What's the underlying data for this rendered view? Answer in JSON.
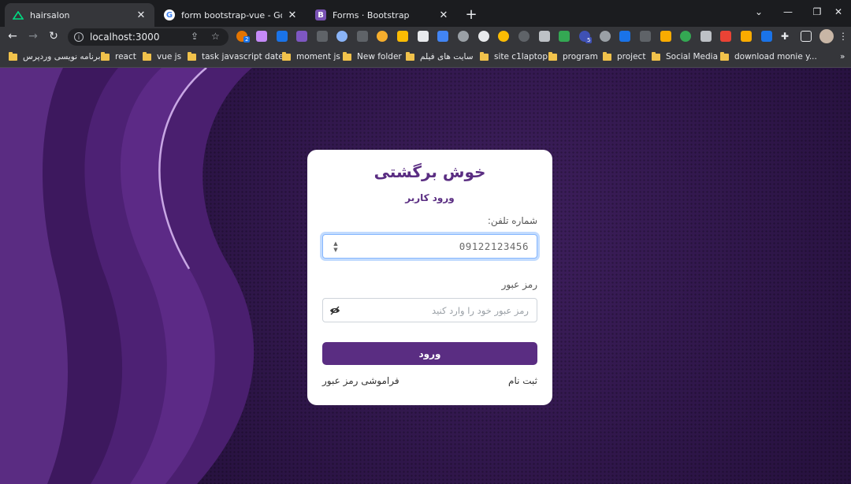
{
  "browser": {
    "tabs": [
      {
        "title": "hairsalon",
        "icon": "nuxt-icon"
      },
      {
        "title": "form bootstrap-vue - Google Sea",
        "icon": "google-icon"
      },
      {
        "title": "Forms · Bootstrap",
        "icon": "bootstrap-icon"
      }
    ],
    "url": "localhost:3000",
    "bookmarks": [
      "برنامه نویسی وردپرس",
      "react",
      "vue js",
      "task javascript date...",
      "moment js",
      "New folder",
      "سایت های فیلم",
      "site c1laptop",
      "program",
      "project",
      "Social Media",
      "download monie y..."
    ],
    "extension_badges": [
      "2",
      "5"
    ]
  },
  "login": {
    "title": "خوش برگشتی",
    "subtitle": "ورود کاربر",
    "phone_label": "شماره تلفن:",
    "phone_value": "09122123456",
    "password_label": "رمز عبور",
    "password_placeholder": "رمز عبور خود را وارد کنید",
    "submit_label": "ورود",
    "signup_link": "ثبت نام",
    "forgot_link": "فراموشی رمز عبور"
  },
  "colors": {
    "accent": "#5a2d82",
    "background": "#2a1343"
  }
}
